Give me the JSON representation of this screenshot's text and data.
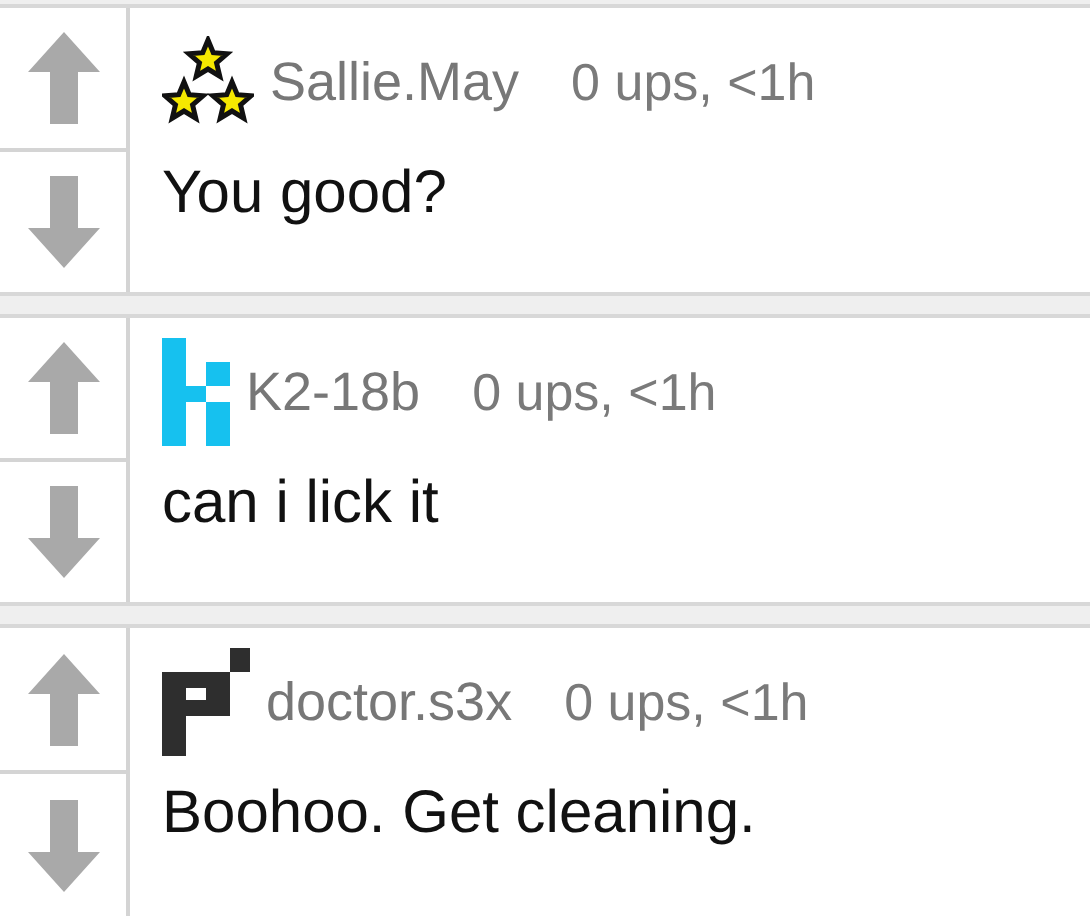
{
  "comments": [
    {
      "kind": "stars",
      "username": "Sallie.May",
      "meta": "0 ups, <1h",
      "text": "You good?"
    },
    {
      "kind": "k-block",
      "username": "K2-18b",
      "meta": "0 ups, <1h",
      "text": "can i lick it"
    },
    {
      "kind": "p-block",
      "username": "doctor.s3x",
      "meta": "0 ups, <1h",
      "text": "Boohoo. Get cleaning."
    }
  ]
}
